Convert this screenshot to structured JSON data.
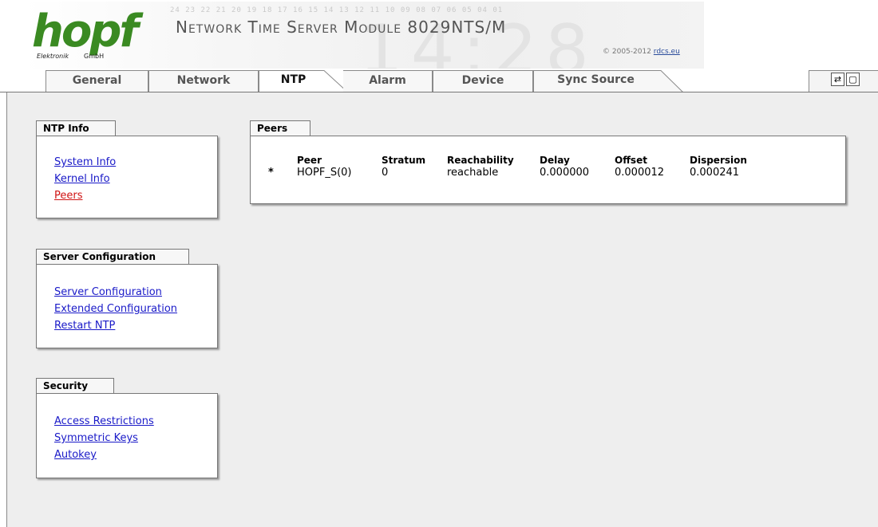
{
  "banner": {
    "logo_text": "hopf",
    "logo_sub_left": "Elektronik",
    "logo_sub_right": "GmbH",
    "number_strip": "24 23 22 21 20 19 18 17 16 15 14 13 12 11 10 09 08 07 06 05 04 01",
    "title": "Network Time Server Module 8029NTS/M",
    "clock_watermark": "14:28",
    "copyright_prefix": "© 2005-2012",
    "copyright_link": "rdcs.eu"
  },
  "tabs": [
    {
      "label": "General"
    },
    {
      "label": "Network"
    },
    {
      "label": "NTP"
    },
    {
      "label": "Alarm"
    },
    {
      "label": "Device"
    },
    {
      "label": "Sync Source"
    }
  ],
  "active_tab": "NTP",
  "toolbar": {
    "refresh_icon": "⇄",
    "window_icon": "▢"
  },
  "sidebar": {
    "ntp_info": {
      "title": "NTP Info",
      "links": [
        "System Info",
        "Kernel Info",
        "Peers"
      ]
    },
    "server_config": {
      "title": "Server Configuration",
      "links": [
        "Server Configuration",
        "Extended Configuration",
        "Restart NTP"
      ]
    },
    "security": {
      "title": "Security",
      "links": [
        "Access Restrictions",
        "Symmetric Keys",
        "Autokey"
      ]
    }
  },
  "peers": {
    "title": "Peers",
    "columns": [
      "Peer",
      "Stratum",
      "Reachability",
      "Delay",
      "Offset",
      "Dispersion"
    ],
    "rows": [
      {
        "marker": "*",
        "peer": "HOPF_S(0)",
        "stratum": "0",
        "reachability": "reachable",
        "delay": "0.000000",
        "offset": "0.000012",
        "dispersion": "0.000241"
      }
    ]
  },
  "colors": {
    "logo_green": "#3a8a22",
    "link_blue": "#1a1ac8",
    "link_active_red": "#d01414",
    "content_bg": "#eeeeee"
  }
}
